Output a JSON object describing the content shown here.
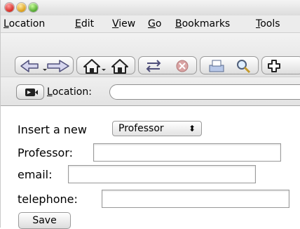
{
  "menubar": {
    "items": [
      {
        "first": "L",
        "rest": "ocation"
      },
      {
        "first": "E",
        "rest": "dit"
      },
      {
        "first": "V",
        "rest": "iew"
      },
      {
        "first": "G",
        "rest": "o"
      },
      {
        "first": "B",
        "rest": "ookmarks"
      },
      {
        "first": "T",
        "rest": "ools"
      }
    ]
  },
  "toolbar": {
    "buttons": [
      "back-icon",
      "forward-icon",
      "home-icon",
      "home-alt-icon",
      "reload-icon",
      "stop-icon",
      "print-icon",
      "search-icon",
      "add-icon"
    ]
  },
  "locationbar": {
    "label_first": "L",
    "label_rest": "ocation:",
    "value": ""
  },
  "form": {
    "insert_label": "Insert a new",
    "select_value": "Professor",
    "select_arrow": "⬍",
    "professor_label": "Professor:",
    "professor_value": "",
    "email_label": "email:",
    "email_value": "",
    "telephone_label": "telephone:",
    "telephone_value": "",
    "save_label": "Save"
  },
  "colors": {
    "close": "#d2241c",
    "minimize": "#d99a10",
    "zoom": "#4ba22a"
  }
}
